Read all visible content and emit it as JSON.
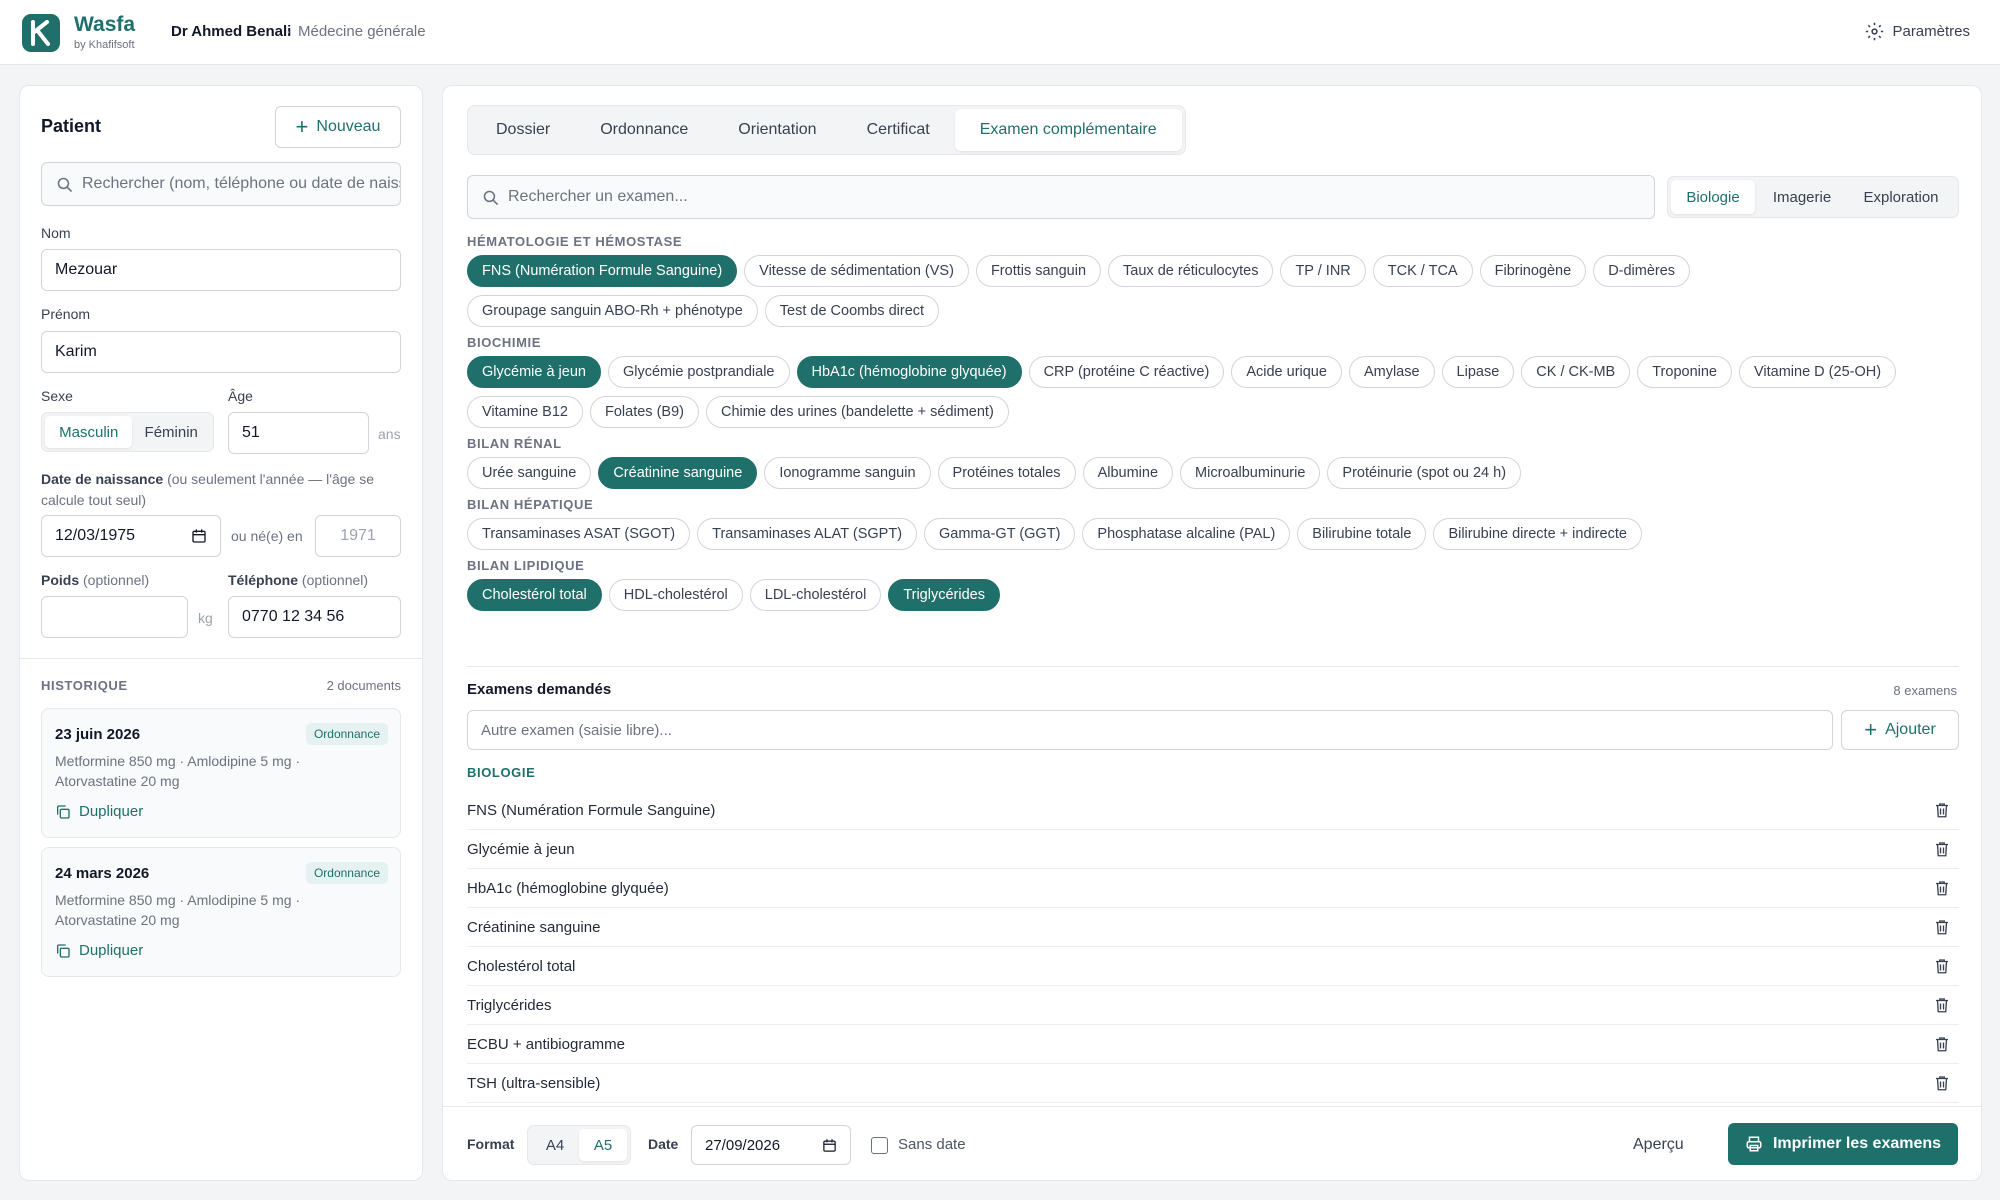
{
  "app": {
    "name": "Wasfa",
    "by": "by Khafifsoft",
    "doctor": "Dr Ahmed Benali",
    "specialty": "Médecine générale",
    "settings": "Paramètres"
  },
  "patient": {
    "title": "Patient",
    "new_button": "Nouveau",
    "search_placeholder": "Rechercher (nom, téléphone ou date de naissance)",
    "nom_label": "Nom",
    "nom": "Mezouar",
    "prenom_label": "Prénom",
    "prenom": "Karim",
    "sexe_label": "Sexe",
    "sexe_options": [
      "Masculin",
      "Féminin"
    ],
    "age_label": "Âge",
    "age": "51",
    "age_unit": "ans",
    "dob_label": "Date de naissance",
    "dob_hint": "(ou seulement l'année — l'âge se calcule tout seul)",
    "dob": "12/03/1975",
    "or_year": "ou né(e) en",
    "year_placeholder": "1971",
    "poids_label": "Poids",
    "optional": "(optionnel)",
    "poids_unit": "kg",
    "tel_label": "Téléphone",
    "tel": "0770 12 34 56"
  },
  "history": {
    "title": "Historique",
    "count": "2 documents",
    "items": [
      {
        "date": "23 juin 2026",
        "badge": "Ordonnance",
        "meds": "Metformine 850 mg · Amlodipine 5 mg · Atorvastatine 20 mg",
        "action": "Dupliquer"
      },
      {
        "date": "24 mars 2026",
        "badge": "Ordonnance",
        "meds": "Metformine 850 mg · Amlodipine 5 mg · Atorvastatine 20 mg",
        "action": "Dupliquer"
      }
    ]
  },
  "tabs": [
    "Dossier",
    "Ordonnance",
    "Orientation",
    "Certificat",
    "Examen complémentaire"
  ],
  "exam_search_placeholder": "Rechercher un examen...",
  "type_tabs": [
    "Biologie",
    "Imagerie",
    "Exploration"
  ],
  "catalog": [
    {
      "title": "Hématologie et hémostase",
      "chips": [
        {
          "label": "FNS (Numération Formule Sanguine)",
          "sel": true
        },
        {
          "label": "Vitesse de sédimentation (VS)"
        },
        {
          "label": "Frottis sanguin"
        },
        {
          "label": "Taux de réticulocytes"
        },
        {
          "label": "TP / INR"
        },
        {
          "label": "TCK / TCA"
        },
        {
          "label": "Fibrinogène"
        },
        {
          "label": "D-dimères"
        },
        {
          "label": "Groupage sanguin ABO-Rh + phénotype"
        },
        {
          "label": "Test de Coombs direct"
        }
      ]
    },
    {
      "title": "Biochimie",
      "chips": [
        {
          "label": "Glycémie à jeun",
          "sel": true
        },
        {
          "label": "Glycémie postprandiale"
        },
        {
          "label": "HbA1c (hémoglobine glyquée)",
          "sel": true
        },
        {
          "label": "CRP (protéine C réactive)"
        },
        {
          "label": "Acide urique"
        },
        {
          "label": "Amylase"
        },
        {
          "label": "Lipase"
        },
        {
          "label": "CK / CK-MB"
        },
        {
          "label": "Troponine"
        },
        {
          "label": "Vitamine D (25-OH)"
        },
        {
          "label": "Vitamine B12"
        },
        {
          "label": "Folates (B9)"
        },
        {
          "label": "Chimie des urines (bandelette + sédiment)"
        }
      ]
    },
    {
      "title": "Bilan rénal",
      "chips": [
        {
          "label": "Urée sanguine"
        },
        {
          "label": "Créatinine sanguine",
          "sel": true
        },
        {
          "label": "Ionogramme sanguin"
        },
        {
          "label": "Protéines totales"
        },
        {
          "label": "Albumine"
        },
        {
          "label": "Microalbuminurie"
        },
        {
          "label": "Protéinurie (spot ou 24 h)"
        }
      ]
    },
    {
      "title": "Bilan hépatique",
      "chips": [
        {
          "label": "Transaminases ASAT (SGOT)"
        },
        {
          "label": "Transaminases ALAT (SGPT)"
        },
        {
          "label": "Gamma-GT (GGT)"
        },
        {
          "label": "Phosphatase alcaline (PAL)"
        },
        {
          "label": "Bilirubine totale"
        },
        {
          "label": "Bilirubine directe + indirecte"
        }
      ]
    },
    {
      "title": "Bilan lipidique",
      "chips": [
        {
          "label": "Cholestérol total",
          "sel": true
        },
        {
          "label": "HDL-cholestérol"
        },
        {
          "label": "LDL-cholestérol"
        },
        {
          "label": "Triglycérides",
          "sel": true
        }
      ]
    }
  ],
  "requested": {
    "title": "Examens demandés",
    "count": "8 examens",
    "free_placeholder": "Autre examen (saisie libre)...",
    "add_button": "Ajouter",
    "group": "Biologie",
    "items": [
      "FNS (Numération Formule Sanguine)",
      "Glycémie à jeun",
      "HbA1c (hémoglobine glyquée)",
      "Créatinine sanguine",
      "Cholestérol total",
      "Triglycérides",
      "ECBU + antibiogramme",
      "TSH (ultra-sensible)"
    ]
  },
  "footer": {
    "format_label": "Format",
    "formats": [
      "A4",
      "A5"
    ],
    "date_label": "Date",
    "date": "27/09/2026",
    "no_date": "Sans date",
    "preview": "Aperçu",
    "print": "Imprimer les examens"
  },
  "colors": {
    "accent": "#1f6f6b",
    "background": "#f3f4f6"
  }
}
